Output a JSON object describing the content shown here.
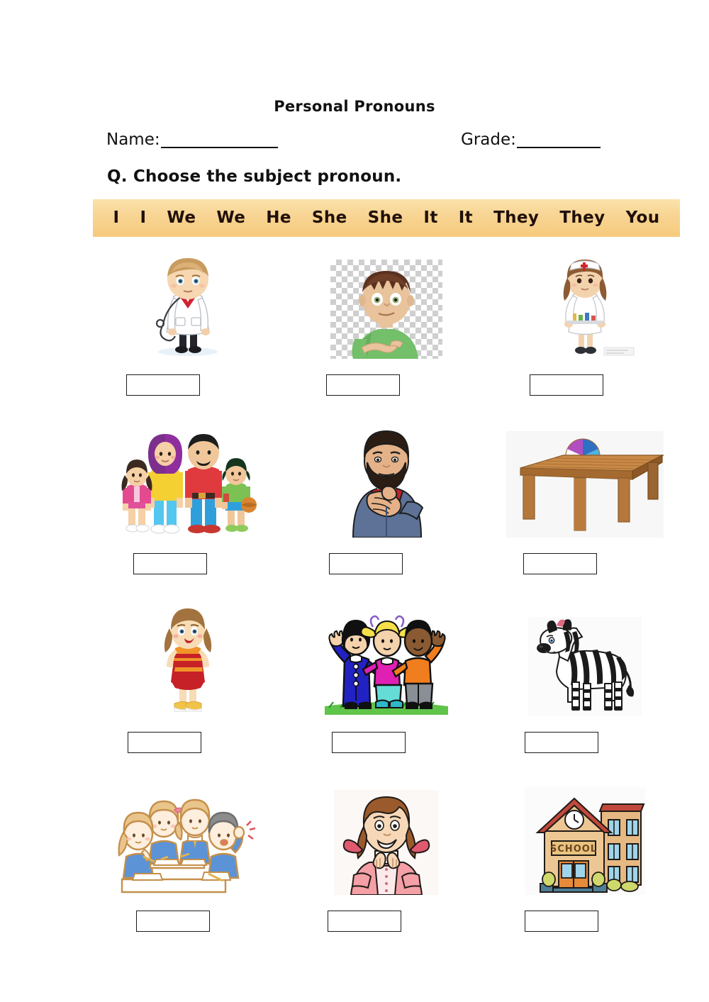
{
  "worksheet": {
    "title": "Personal Pronouns",
    "name_label": "Name:",
    "grade_label": "Grade:",
    "instruction": "Q. Choose the subject pronoun."
  },
  "word_bank": {
    "background_color": "#F6CA7C",
    "words": [
      "I",
      "I",
      "We",
      "We",
      "He",
      "She",
      "She",
      "It",
      "It",
      "They",
      "They",
      "You"
    ]
  },
  "items": [
    {
      "row": 1,
      "cells": [
        {
          "picture": "doctor-with-stethoscope",
          "answer": ""
        },
        {
          "picture": "boy-pointing-at-himself",
          "answer": ""
        },
        {
          "picture": "nurse-holding-tray",
          "answer": ""
        }
      ]
    },
    {
      "row": 2,
      "cells": [
        {
          "picture": "family-of-four",
          "answer": ""
        },
        {
          "picture": "bearded-man-pointing-at-himself",
          "answer": ""
        },
        {
          "picture": "wooden-table-with-beach-ball",
          "answer": ""
        }
      ]
    },
    {
      "row": 3,
      "cells": [
        {
          "picture": "girl-in-red-dress",
          "answer": ""
        },
        {
          "picture": "three-children-waving",
          "answer": ""
        },
        {
          "picture": "zebra",
          "answer": ""
        }
      ]
    },
    {
      "row": 4,
      "cells": [
        {
          "picture": "students-in-classroom",
          "answer": ""
        },
        {
          "picture": "girl-pointing-at-herself",
          "answer": ""
        },
        {
          "picture": "school-building",
          "answer": ""
        }
      ]
    }
  ],
  "picture_text": {
    "school_sign": "SCHOOL"
  }
}
